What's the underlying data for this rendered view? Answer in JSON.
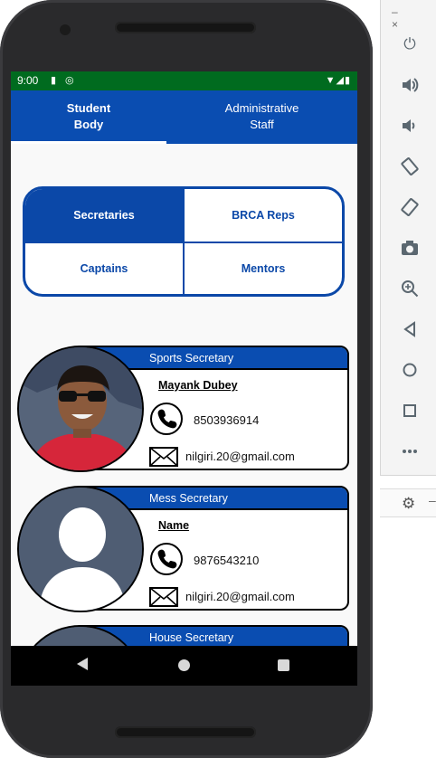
{
  "status_bar": {
    "time": "9:00"
  },
  "tabs": [
    {
      "line1": "Student",
      "line2": "Body"
    },
    {
      "line1": "Administrative",
      "line2": "Staff"
    }
  ],
  "segments": [
    "Secretaries",
    "BRCA Reps",
    "Captains",
    "Mentors"
  ],
  "cards": [
    {
      "title": "Sports Secretary",
      "name": "Mayank Dubey",
      "phone": "8503936914",
      "email": "nilgiri.20@gmail.com"
    },
    {
      "title": "Mess Secretary",
      "name": "Name",
      "phone": "9876543210",
      "email": "nilgiri.20@gmail.com"
    },
    {
      "title": "House Secretary"
    }
  ],
  "colors": {
    "primary": "#0a4db1",
    "status_bar": "#006b1f"
  },
  "icons": [
    "phone-icon",
    "mail-icon",
    "power-icon",
    "volume-up-icon",
    "volume-down-icon",
    "rotate-left-icon",
    "rotate-right-icon",
    "camera-icon",
    "zoom-icon",
    "back-icon",
    "home-icon",
    "overview-icon",
    "more-icon",
    "settings-icon"
  ]
}
